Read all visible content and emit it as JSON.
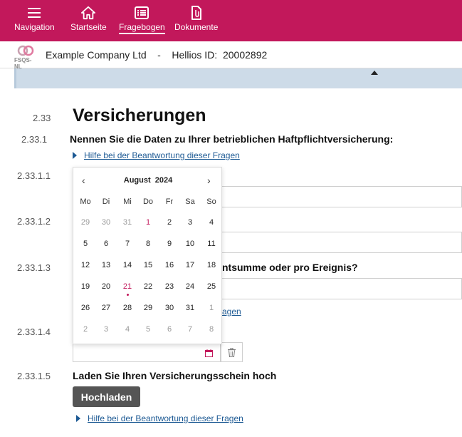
{
  "nav": {
    "items": [
      {
        "label": "Navigation",
        "icon": "menu-icon",
        "active": false
      },
      {
        "label": "Startseite",
        "icon": "home-icon",
        "active": false
      },
      {
        "label": "Fragebogen",
        "icon": "questionnaire-icon",
        "active": true
      },
      {
        "label": "Dokumente",
        "icon": "documents-icon",
        "active": false
      }
    ]
  },
  "company": {
    "logo_text": "FSQS-NL",
    "line": "Example Company Ltd    -    Hellios ID:  20002892"
  },
  "section": {
    "number": "2.33",
    "title": "Versicherungen"
  },
  "q1": {
    "number": "2.33.1",
    "text": "Nennen Sie die Daten zu Ihrer betrieblichen Haftpflichtversicherung:",
    "help": "Hilfe bei der Beantwortung dieser Fragen"
  },
  "q111": {
    "number": "2.33.1.1"
  },
  "q112": {
    "number": "2.33.1.2"
  },
  "q113": {
    "number": "2.33.1.3",
    "text_partial": "ntsumme oder pro Ereignis?",
    "help_partial": "agen"
  },
  "q114": {
    "number": "2.33.1.4"
  },
  "q115": {
    "number": "2.33.1.5",
    "text": "Laden Sie Ihren Versicherungsschein hoch",
    "button": "Hochladen",
    "help": "Hilfe bei der Beantwortung dieser Fragen"
  },
  "calendar": {
    "month_label": "August  2024",
    "prev": "‹",
    "next": "›",
    "weekdays": [
      "Mo",
      "Di",
      "Mi",
      "Do",
      "Fr",
      "Sa",
      "So"
    ],
    "weeks": [
      [
        "29",
        "30",
        "31",
        "1",
        "2",
        "3",
        "4"
      ],
      [
        "5",
        "6",
        "7",
        "8",
        "9",
        "10",
        "11"
      ],
      [
        "12",
        "13",
        "14",
        "15",
        "16",
        "17",
        "18"
      ],
      [
        "19",
        "20",
        "21",
        "22",
        "23",
        "24",
        "25"
      ],
      [
        "26",
        "27",
        "28",
        "29",
        "30",
        "31",
        "1"
      ],
      [
        "2",
        "3",
        "4",
        "5",
        "6",
        "7",
        "8"
      ]
    ],
    "today": "21",
    "accent": "#c2185b"
  },
  "colors": {
    "brand": "#c2185b",
    "link": "#1d5a94",
    "strip": "#cddbe8",
    "button": "#555555"
  }
}
